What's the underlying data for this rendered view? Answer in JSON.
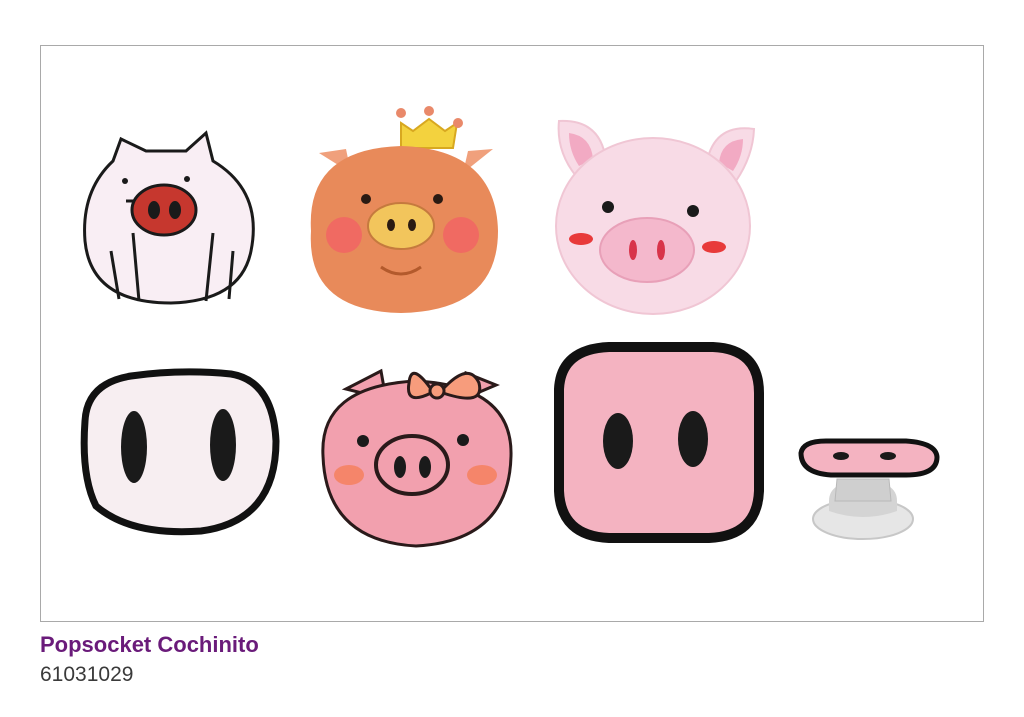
{
  "product": {
    "name": "Popsocket Cochinito",
    "code": "61031029"
  },
  "items": [
    {
      "icon": "white-pig-outline-icon",
      "color": "#f9eef4"
    },
    {
      "icon": "orange-pig-crown-icon",
      "color": "#e88a5a"
    },
    {
      "icon": "pale-pink-pig-icon",
      "color": "#f8dbe6"
    },
    {
      "icon": "white-pig-snout-icon",
      "color": "#f7eef1"
    },
    {
      "icon": "pink-pig-bow-icon",
      "color": "#f2a0ae"
    },
    {
      "icon": "square-pig-snout-icon",
      "color": "#f4b3c1"
    },
    {
      "icon": "popsocket-grip-side-view-icon",
      "color": "#d9d9d9"
    }
  ]
}
